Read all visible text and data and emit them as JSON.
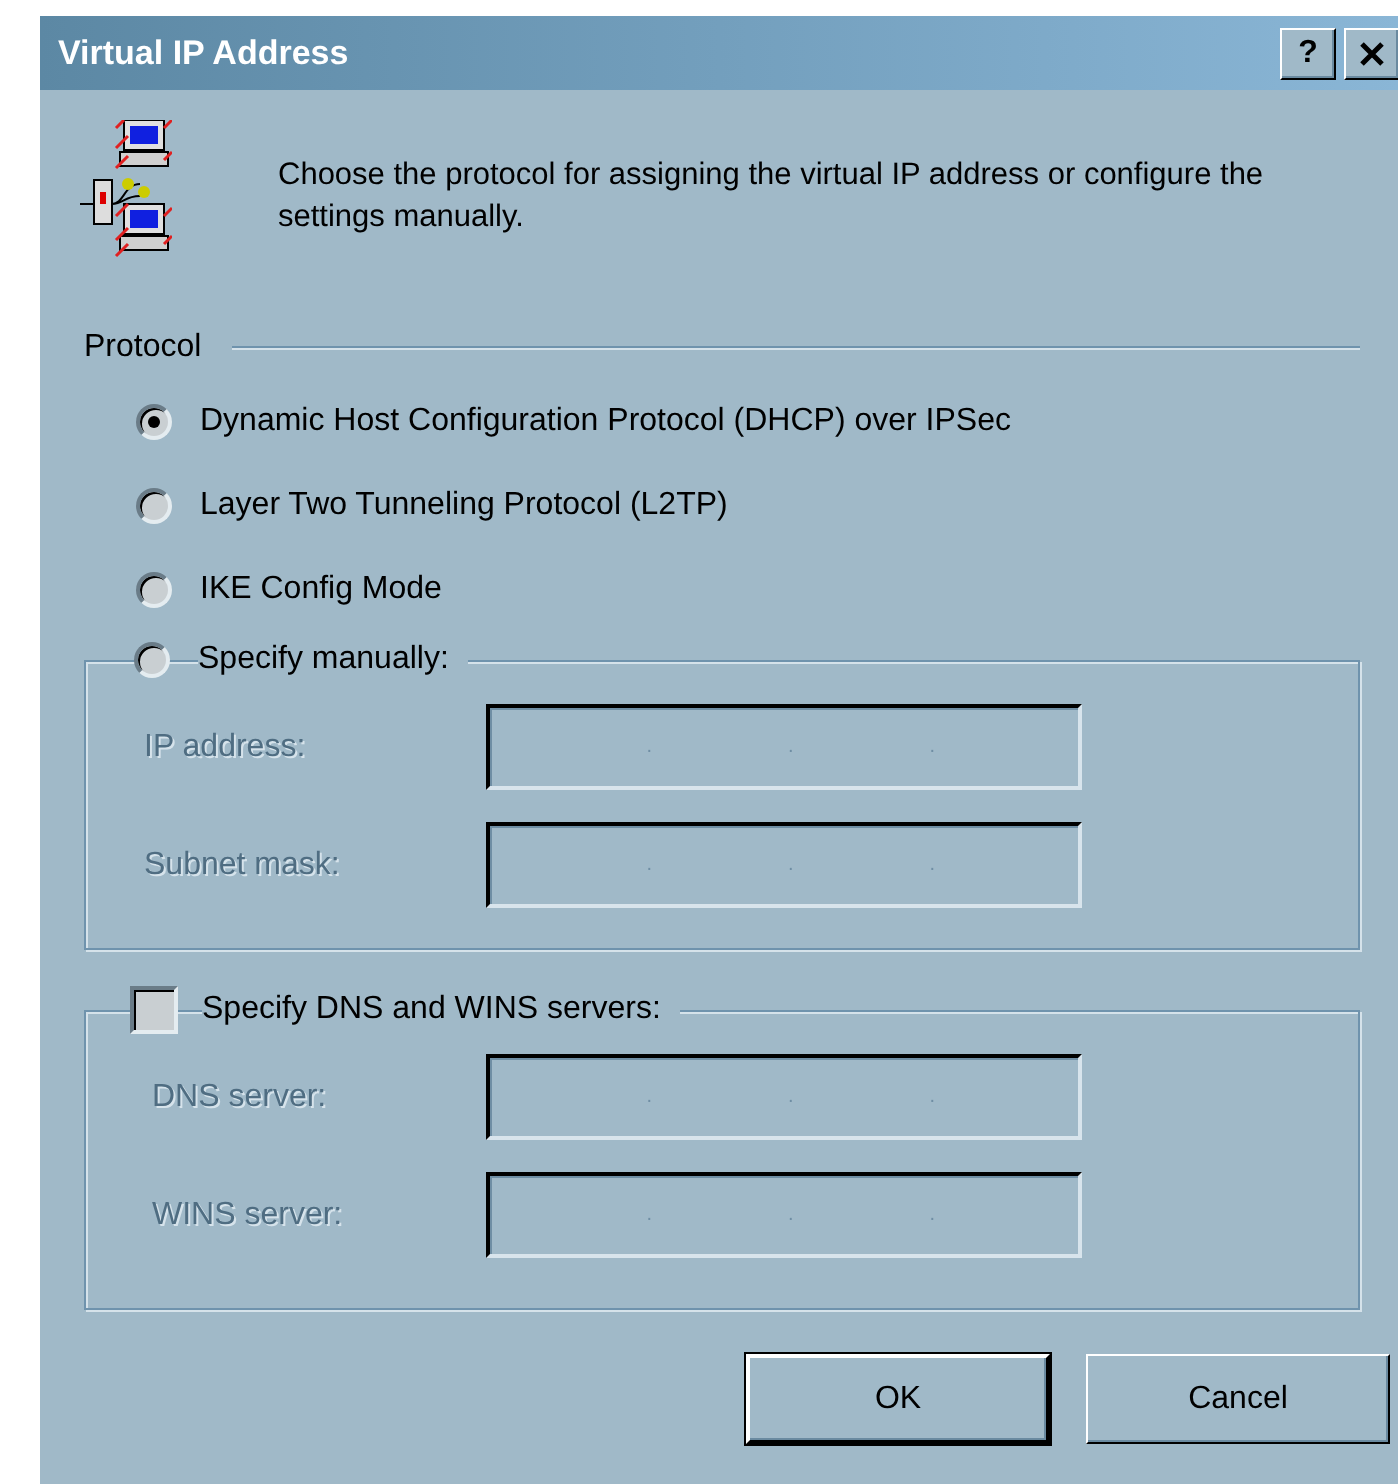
{
  "window": {
    "title": "Virtual IP Address",
    "help_button": "?"
  },
  "intro": "Choose the protocol for assigning the virtual IP address or configure the settings manually.",
  "protocol": {
    "label": "Protocol",
    "options": [
      {
        "label": "Dynamic Host Configuration Protocol (DHCP) over IPSec",
        "selected": true
      },
      {
        "label": "Layer Two Tunneling Protocol (L2TP)",
        "selected": false
      },
      {
        "label": "IKE Config Mode",
        "selected": false
      },
      {
        "label": "Specify manually:",
        "selected": false
      }
    ]
  },
  "manual_fields": [
    {
      "label": "IP address:",
      "disabled": true,
      "separators": [
        ".",
        ".",
        "."
      ]
    },
    {
      "label": "Subnet mask:",
      "disabled": true,
      "separators": [
        ".",
        ".",
        "."
      ]
    }
  ],
  "dns": {
    "label": "Specify DNS and WINS servers:",
    "checked": false,
    "fields": [
      {
        "label": "DNS server:",
        "disabled": true,
        "separators": [
          ".",
          ".",
          "."
        ]
      },
      {
        "label": "WINS server:",
        "disabled": true,
        "separators": [
          ".",
          ".",
          "."
        ]
      }
    ]
  },
  "buttons": [
    {
      "label": "OK",
      "default": true
    },
    {
      "label": "Cancel",
      "default": false
    }
  ]
}
